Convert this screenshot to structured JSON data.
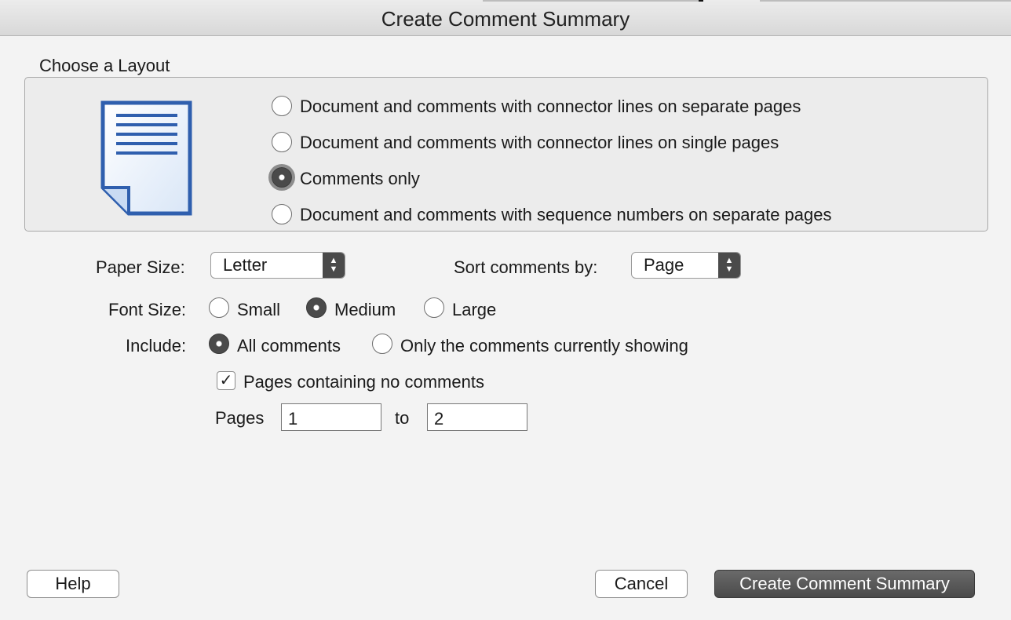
{
  "window": {
    "title": "Create Comment Summary"
  },
  "layout": {
    "heading": "Choose a Layout",
    "options": [
      {
        "label": "Document and comments with connector lines on separate pages",
        "selected": false
      },
      {
        "label": "Document and comments with connector lines on single pages",
        "selected": false
      },
      {
        "label": "Comments only",
        "selected": true
      },
      {
        "label": "Document and comments with sequence numbers on separate pages",
        "selected": false
      }
    ]
  },
  "paper_size": {
    "label": "Paper Size:",
    "value": "Letter"
  },
  "sort": {
    "label": "Sort comments by:",
    "value": "Page"
  },
  "font_size": {
    "label": "Font Size:",
    "options": [
      {
        "label": "Small",
        "selected": false
      },
      {
        "label": "Medium",
        "selected": true
      },
      {
        "label": "Large",
        "selected": false
      }
    ]
  },
  "include": {
    "label": "Include:",
    "options": [
      {
        "label": "All comments",
        "selected": true
      },
      {
        "label": "Only the comments currently showing",
        "selected": false
      }
    ]
  },
  "pages_no_comments": {
    "label": "Pages containing no comments",
    "checked": true
  },
  "page_range": {
    "label": "Pages",
    "from": "1",
    "to_label": "to",
    "to": "2"
  },
  "buttons": {
    "help": "Help",
    "cancel": "Cancel",
    "create": "Create Comment Summary"
  },
  "icons": {
    "check": "✓",
    "popup_arrows": "▲▼"
  },
  "colors": {
    "document_icon_blue": "#2f5fae",
    "primary_button": "#4a4a4a"
  }
}
